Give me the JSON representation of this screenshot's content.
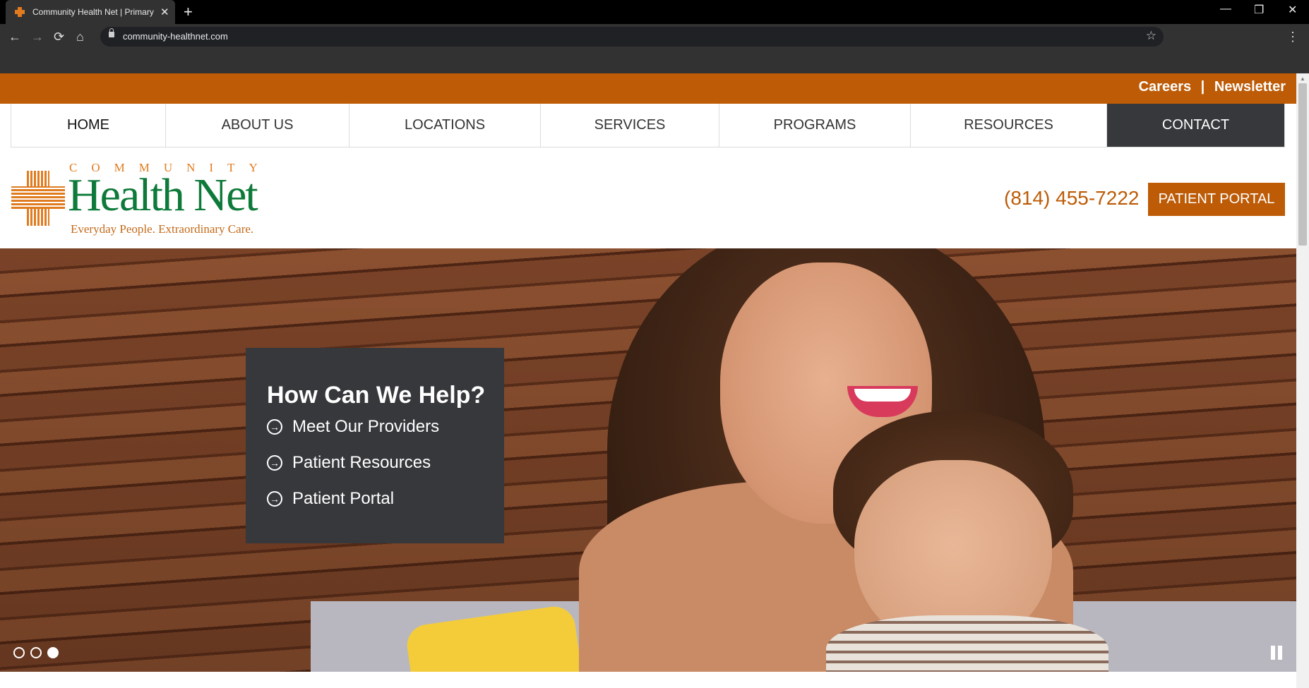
{
  "browser": {
    "tab_title": "Community Health Net | Primary",
    "new_tab": "+",
    "tab_close": "✕",
    "url": "community-healthnet.com",
    "nav": {
      "back": "←",
      "forward": "→",
      "reload": "⟳",
      "home": "⌂",
      "star": "☆",
      "menu": "⋮"
    },
    "window": {
      "minimize": "—",
      "restore": "❐",
      "close": "✕"
    }
  },
  "topbar": {
    "careers": "Careers",
    "separator": "|",
    "newsletter": "Newsletter"
  },
  "nav": {
    "items": [
      {
        "label": "HOME"
      },
      {
        "label": "ABOUT US"
      },
      {
        "label": "LOCATIONS"
      },
      {
        "label": "SERVICES"
      },
      {
        "label": "PROGRAMS"
      },
      {
        "label": "RESOURCES"
      },
      {
        "label": "CONTACT"
      }
    ]
  },
  "logo": {
    "community": "COMMUNITY",
    "brand": "Health Net",
    "tagline": "Everyday People. Extraordinary Care."
  },
  "phone": "(814) 455-7222",
  "portal_button": "PATIENT PORTAL",
  "hero": {
    "heading": "How Can We Help?",
    "links": [
      "Meet Our Providers",
      "Patient Resources",
      "Patient Portal"
    ],
    "slides": {
      "count": 3,
      "active_index": 2
    }
  },
  "colors": {
    "brand_orange": "#bd5b06",
    "brand_green": "#0e7a3a",
    "dark": "#36383b"
  }
}
